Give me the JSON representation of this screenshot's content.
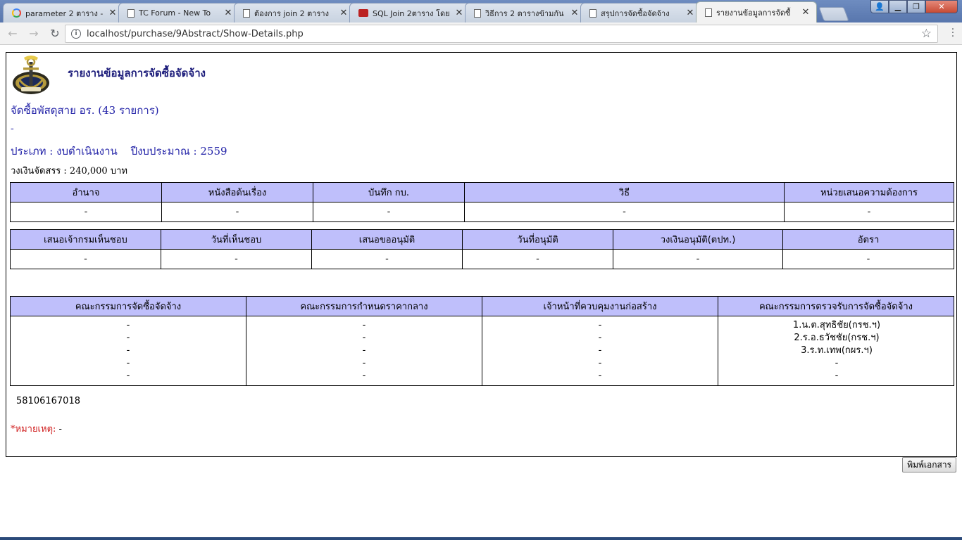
{
  "browser": {
    "tabs": [
      {
        "label": "parameter 2 ตาราง -",
        "icon": "google-icon",
        "active": false
      },
      {
        "label": "TC Forum - New To",
        "icon": "document-icon",
        "active": false
      },
      {
        "label": "ต้องการ join 2 ตาราง",
        "icon": "document-icon",
        "active": false
      },
      {
        "label": "SQL Join 2ตาราง โดย",
        "icon": "sql-site-icon",
        "active": false
      },
      {
        "label": "วิธีการ 2 ตารางข้ามกัน",
        "icon": "document-icon",
        "active": false
      },
      {
        "label": "สรุปการจัดซื้อจัดจ้าง",
        "icon": "document-icon",
        "active": false
      },
      {
        "label": "รายงานข้อมูลการจัดซื้",
        "icon": "document-icon",
        "active": true
      }
    ],
    "url": "localhost/purchase/9Abstract/Show-Details.php"
  },
  "report": {
    "title": "รายงานข้อมูลการจัดซื้อจัดจ้าง",
    "item_line": "จัดซื้อพัสดุสาย อร. (43 รายการ)",
    "dash_line": "-",
    "type_line": "ประเภท : งบดำเนินงาน",
    "fiscal_line": "ปีงบประมาณ : 2559",
    "budget_line": "วงเงินจัดสรร : 240,000 บาท",
    "table1": {
      "headers": [
        "อำนาจ",
        "หนังสือต้นเรื่อง",
        "บันทึก กบ.",
        "วิธี",
        "หน่วยเสนอความต้องการ"
      ],
      "row": [
        "-",
        "-",
        "-",
        "-",
        "-"
      ]
    },
    "table2": {
      "headers": [
        "เสนอเจ้ากรมเห็นชอบ",
        "วันที่เห็นชอบ",
        "เสนอขออนุมัติ",
        "วันที่อนุมัติ",
        "วงเงินอนุมัติ(ตปท.)",
        "อัตรา"
      ],
      "row": [
        "-",
        "-",
        "-",
        "-",
        "-",
        "-"
      ]
    },
    "table3": {
      "headers": [
        "คณะกรรมการจัดซื้อจัดจ้าง",
        "คณะกรรมการกำหนดราคากลาง",
        "เจ้าหน้าที่ควบคุมงานก่อสร้าง",
        "คณะกรรมการตรวจรับการจัดซื้อจัดจ้าง"
      ],
      "columns": [
        [
          "-",
          "-",
          "-",
          "-",
          "-"
        ],
        [
          "-",
          "-",
          "-",
          "-",
          "-"
        ],
        [
          "-",
          "-",
          "-",
          "-",
          "-"
        ],
        [
          "1.น.ต.สุทธิชัย(กรช.ฯ)",
          "2.ร.อ.ธวัชชัย(กรช.ฯ)",
          "3.ร.ท.เทพ(กผร.ฯ)",
          " -",
          " -"
        ]
      ]
    },
    "project_no": "58106167018",
    "note_label": "*หมายเหตุ:",
    "note_value": "-"
  },
  "print_button": "พิมพ์เอกสาร",
  "colors": {
    "header_bg": "#bfbffb",
    "title": "#1b1b7a",
    "text_blue": "#2323a8",
    "note_red": "#d02020"
  }
}
